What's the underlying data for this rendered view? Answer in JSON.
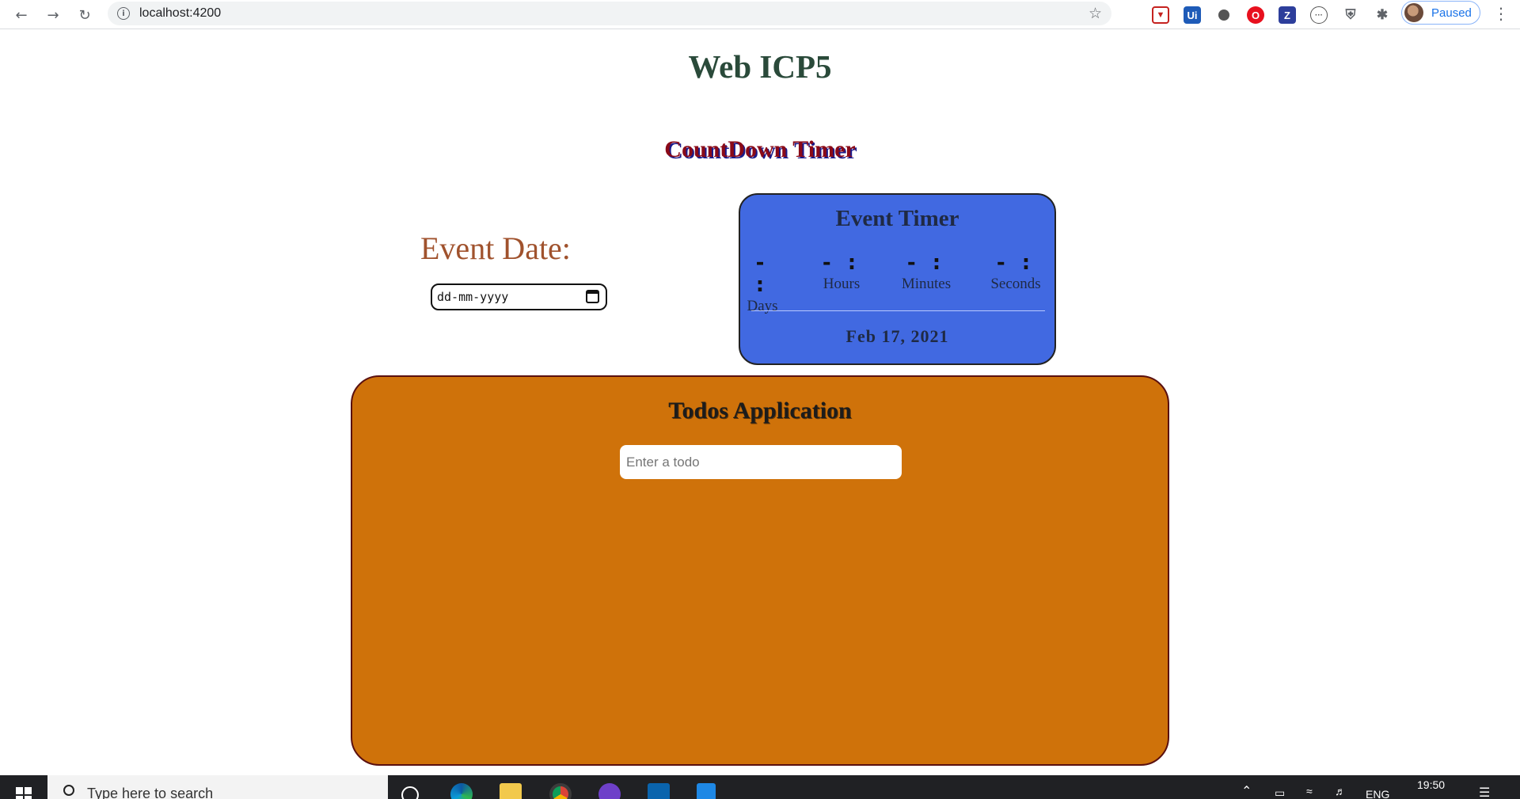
{
  "browser": {
    "url": "localhost:4200",
    "profile_label": "Paused"
  },
  "page": {
    "title": "Web ICP5",
    "countdown_title": "CountDown Timer",
    "event_date_label": "Event Date:",
    "date_placeholder": "dd-mm-yyyy"
  },
  "timer": {
    "title": "Event Timer",
    "units": [
      {
        "value": "- :",
        "label": "Days"
      },
      {
        "value": "- :",
        "label": "Hours"
      },
      {
        "value": "- :",
        "label": "Minutes"
      },
      {
        "value": "- :",
        "label": "Seconds"
      }
    ],
    "date": "Feb 17, 2021"
  },
  "todos": {
    "title": "Todos Application",
    "input_placeholder": "Enter a todo"
  },
  "taskbar": {
    "search_placeholder": "Type here to search",
    "time": "19:50",
    "language": "ENG"
  },
  "colors": {
    "timer_card": "#4169e1",
    "todo_card": "#cf720a",
    "event_label": "#a0522d"
  }
}
